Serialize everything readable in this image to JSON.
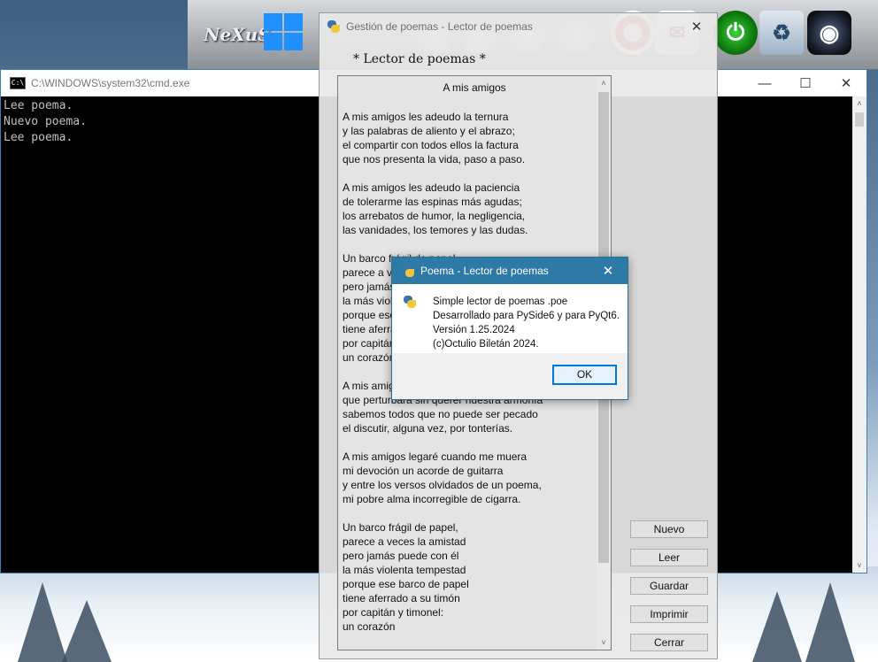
{
  "cmd": {
    "title": "C:\\WINDOWS\\system32\\cmd.exe",
    "lines": [
      "Lee poema.",
      "Nuevo poema.",
      "Lee poema."
    ]
  },
  "caption": {
    "minimize": "—",
    "maximize": "☐",
    "close": "✕"
  },
  "reader": {
    "title": "Gestión de poemas - Lector de poemas",
    "heading": "* Lector de poemas *",
    "poem_title": "A mis amigos",
    "poem_text": "A mis amigos les adeudo la ternura\ny las palabras de aliento y el abrazo;\nel compartir con todos ellos la factura\nque nos presenta la vida, paso a paso.\n\nA mis amigos les adeudo la paciencia\nde tolerarme las espinas más agudas;\nlos arrebatos de humor, la negligencia,\nlas vanidades, los temores y las dudas.\n\nUn barco frágil de papel\nparece a veces la amistad\npero jamás puede con él\nla más violenta tempestad\nporque ese barco de papel\ntiene aferrado a su timón\npor capitán y timonel:\nun corazón.\n\nA mis amigos les adeudo algún enojo\nque perturbara sin querer nuestra armonía\nsabemos todos que no puede ser pecado\nel discutir, alguna vez, por tonterías.\n\nA mis amigos legaré cuando me muera\nmi devoción un acorde de guitarra\ny entre los versos olvidados de un poema,\nmi pobre alma incorregible de cigarra.\n\nUn barco frágil de papel,\nparece a veces la amistad\npero jamás puede con él\nla más violenta tempestad\nporque ese barco de papel\ntiene aferrado a su timón\npor capitán y timonel:\nun corazón",
    "buttons": {
      "nuevo": "Nuevo",
      "leer": "Leer",
      "guardar": "Guardar",
      "imprimir": "Imprimir",
      "cerrar": "Cerrar"
    },
    "scroll_up": "˄",
    "scroll_down": "˅"
  },
  "dialog": {
    "title": "Poema - Lector de poemas",
    "lines": [
      "Simple lector de poemas .poe",
      "Desarrollado para PySide6 y para PyQt6.",
      "Versión 1.25.2024",
      "(c)Octulio Biletán 2024."
    ],
    "ok": "OK"
  },
  "dock": {
    "logo": "NeXuS"
  }
}
